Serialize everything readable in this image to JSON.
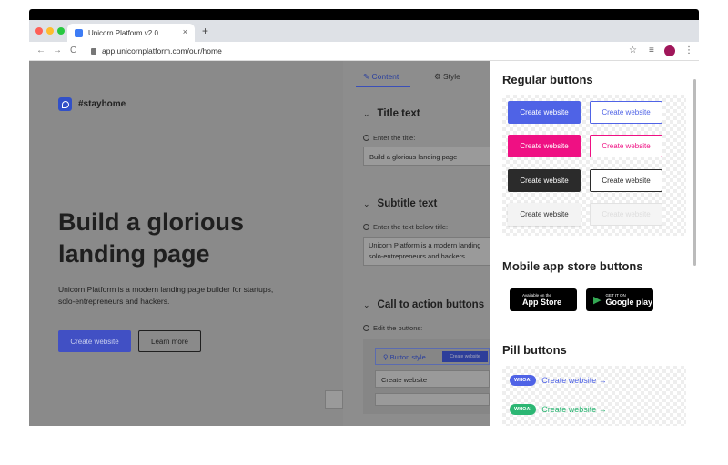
{
  "browser": {
    "tab_title": "Unicorn Platform v2.0",
    "tab_close": "×",
    "new_tab": "+",
    "url": "app.unicornplatform.com/our/home",
    "nav_back": "←",
    "nav_forward": "→",
    "nav_reload": "C",
    "star": "☆",
    "playlist": "≡",
    "menu": "⋮",
    "traffic_lights": [
      "#fe5f57",
      "#febc2e",
      "#28c840"
    ]
  },
  "preview": {
    "brand": "#stayhome",
    "title": "Build a glorious landing page",
    "subtitle": "Unicorn Platform is a modern landing page builder for startups, solo-entrepreneurs and hackers.",
    "primary_button": "Create website",
    "secondary_button": "Learn more"
  },
  "editor": {
    "tabs": {
      "content": "Content",
      "style": "Style"
    },
    "title_section": {
      "heading": "Title text",
      "hint": "Enter the title:",
      "value": "Build a glorious landing page"
    },
    "subtitle_section": {
      "heading": "Subtitle text",
      "hint": "Enter the text below title:",
      "value_line1": "Unicorn Platform is a modern landing",
      "value_line2": "solo-entrepreneurs and hackers."
    },
    "cta_section": {
      "heading": "Call to action buttons",
      "hint": "Edit the buttons:",
      "button_style": "Button style",
      "mini_button": "Create website",
      "field_value": "Create website"
    }
  },
  "panel": {
    "regular_title": "Regular buttons",
    "button_label": "Create website",
    "colors": {
      "blue": "#4f63e6",
      "pink": "#ef1083",
      "dark": "#2b2b2b",
      "light": "#f3f3f3"
    },
    "mobile_title": "Mobile app store buttons",
    "appstore": {
      "small": "Available on the",
      "big": "App Store"
    },
    "googleplay": {
      "small": "GET IT ON",
      "big": "Google play"
    },
    "pill_title": "Pill buttons",
    "pills": [
      {
        "badge": "WHOA!",
        "label": "Create website →",
        "color": "#4f63e6"
      },
      {
        "badge": "WHOA!",
        "label": "Create website →",
        "color": "#2bb673"
      }
    ]
  }
}
